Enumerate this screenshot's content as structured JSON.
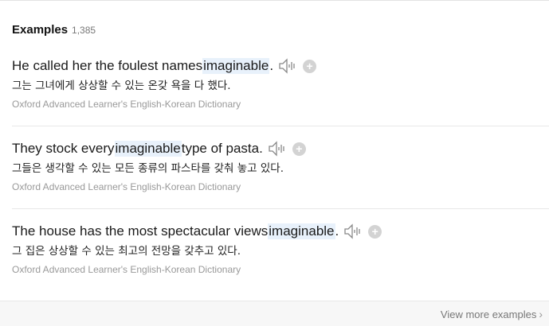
{
  "examples": {
    "title": "Examples",
    "count": "1,385",
    "items": [
      {
        "before": "He called her the foulest names ",
        "highlight": "imaginable",
        "after": ".",
        "korean": "그는 그녀에게 상상할 수 있는 온갖 욕을 다 했다.",
        "source": "Oxford Advanced Learner's English-Korean Dictionary"
      },
      {
        "before": "They stock every ",
        "highlight": "imaginable",
        "after": " type of pasta.",
        "korean": "그들은 생각할 수 있는 모든 종류의 파스타를 갖춰 놓고 있다.",
        "source": "Oxford Advanced Learner's English-Korean Dictionary"
      },
      {
        "before": "The house has the most spectacular views ",
        "highlight": "imaginable",
        "after": ".",
        "korean": "그 집은 상상할 수 있는 최고의 전망을 갖추고 있다.",
        "source": "Oxford Advanced Learner's English-Korean Dictionary"
      }
    ]
  },
  "icons": {
    "speaker": "speaker-icon",
    "add": "plus-icon",
    "more": "chevron-right-icon"
  },
  "footer": {
    "view_more": "View more examples"
  },
  "colors": {
    "highlight": "#e8f1fb",
    "muted": "#999999"
  }
}
